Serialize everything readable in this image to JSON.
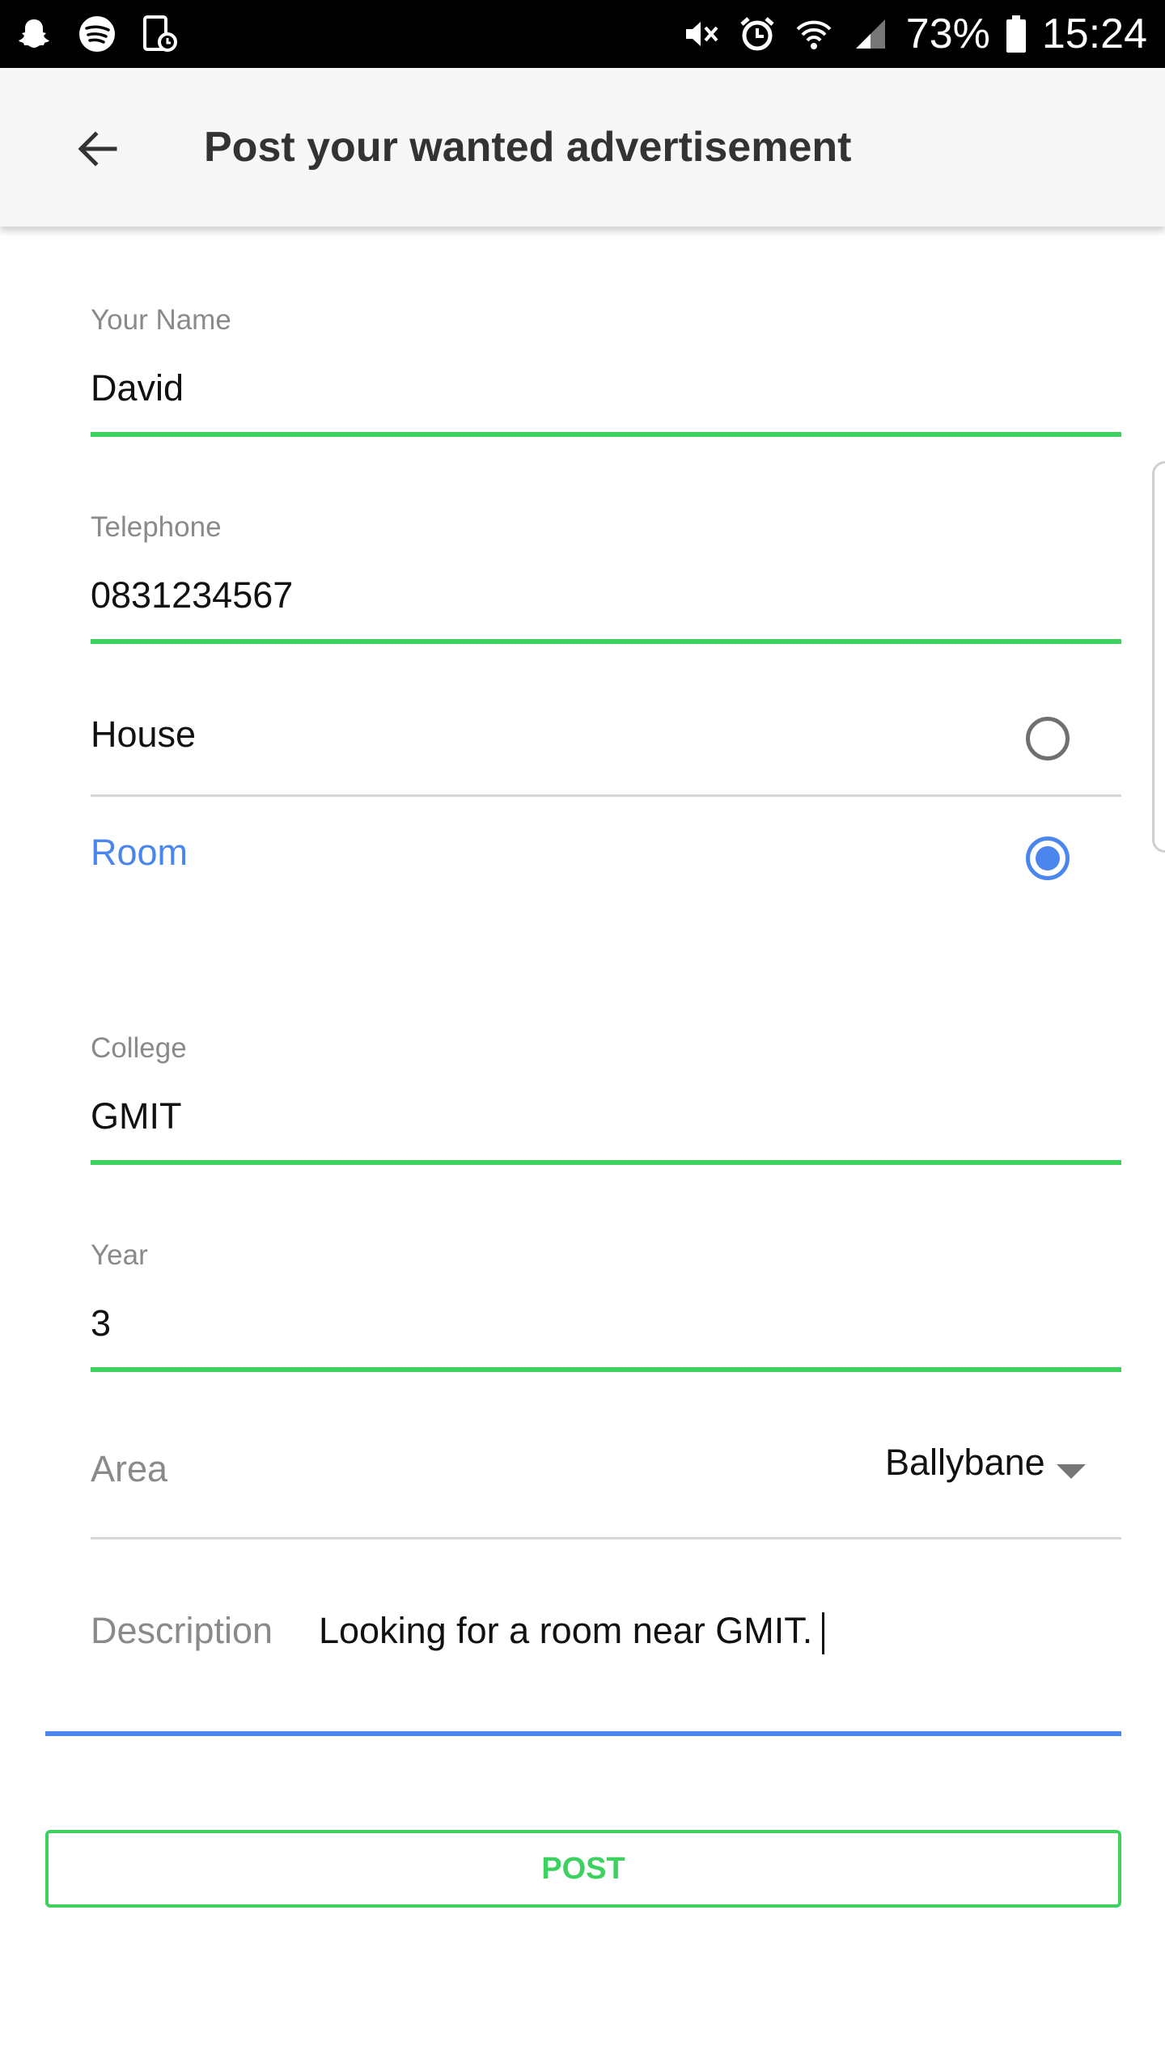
{
  "status_bar": {
    "left_icons": [
      "snapchat-icon",
      "spotify-icon",
      "screenshot-icon"
    ],
    "right_icons": [
      "mute-icon",
      "alarm-icon",
      "wifi-icon",
      "signal-icon",
      "battery-icon"
    ],
    "battery": "73%",
    "time": "15:24"
  },
  "toolbar": {
    "back_icon": "arrow-left-icon",
    "title": "Post your wanted advertisement"
  },
  "form": {
    "name": {
      "label": "Your Name",
      "value": "David"
    },
    "telephone": {
      "label": "Telephone",
      "value": "0831234567"
    },
    "type_options": [
      {
        "label": "House",
        "selected": false
      },
      {
        "label": "Room",
        "selected": true
      }
    ],
    "college": {
      "label": "College",
      "value": "GMIT"
    },
    "year": {
      "label": "Year",
      "value": "3"
    },
    "area": {
      "label": "Area",
      "value": "Ballybane"
    },
    "description": {
      "label": "Description",
      "value": "Looking for a room near GMIT."
    },
    "post_label": "POST"
  },
  "colors": {
    "accent_green": "#3dd160",
    "accent_blue": "#4a86ee"
  }
}
